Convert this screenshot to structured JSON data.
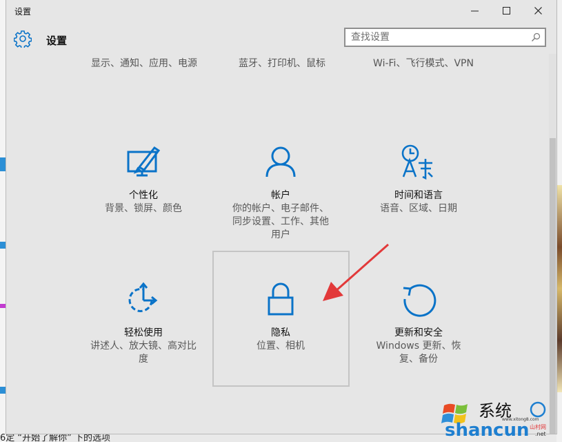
{
  "window": {
    "title": "设置"
  },
  "header": {
    "title": "设置",
    "search_placeholder": "查找设置"
  },
  "top_row": [
    {
      "desc": "显示、通知、应用、电源"
    },
    {
      "desc": "蓝牙、打印机、鼠标"
    },
    {
      "desc": "Wi-Fi、飞行模式、VPN"
    }
  ],
  "tiles": [
    {
      "name": "个性化",
      "desc": "背景、锁屏、颜色",
      "icon": "personalization-icon"
    },
    {
      "name": "帐户",
      "desc": "你的帐户、电子邮件、同步设置、工作、其他用户",
      "icon": "accounts-icon"
    },
    {
      "name": "时间和语言",
      "desc": "语音、区域、日期",
      "icon": "time-language-icon"
    },
    {
      "name": "轻松使用",
      "desc": "讲述人、放大镜、高对比度",
      "icon": "ease-of-access-icon"
    },
    {
      "name": "隐私",
      "desc": "位置、相机",
      "icon": "privacy-lock-icon"
    },
    {
      "name": "更新和安全",
      "desc": "Windows 更新、恢复、备份",
      "icon": "update-security-icon"
    }
  ],
  "background": {
    "bottom_text": "6定 “开始了解你” 下的选项"
  },
  "watermark": {
    "text1": "系统",
    "text2": "shancun",
    "text3": "山村网",
    "text4": ".net",
    "site": "www.xitong8.com"
  },
  "colors": {
    "accent": "#0a73c8",
    "arrow": "#e2393a"
  }
}
